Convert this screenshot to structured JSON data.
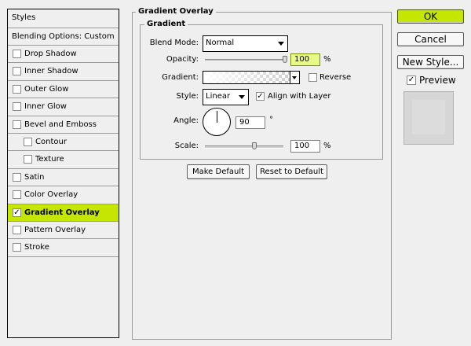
{
  "sidebar": {
    "header": "Styles",
    "blending_options": "Blending Options: Custom",
    "items": [
      {
        "label": "Drop Shadow",
        "checked": false
      },
      {
        "label": "Inner Shadow",
        "checked": false
      },
      {
        "label": "Outer Glow",
        "checked": false
      },
      {
        "label": "Inner Glow",
        "checked": false
      },
      {
        "label": "Bevel and Emboss",
        "checked": false
      },
      {
        "label": "Contour",
        "checked": false
      },
      {
        "label": "Texture",
        "checked": false
      },
      {
        "label": "Satin",
        "checked": false
      },
      {
        "label": "Color Overlay",
        "checked": false
      },
      {
        "label": "Gradient Overlay",
        "checked": true
      },
      {
        "label": "Pattern Overlay",
        "checked": false
      },
      {
        "label": "Stroke",
        "checked": false
      }
    ],
    "check_mark": "✓",
    "active_color": "#c4e600"
  },
  "panel": {
    "title": "Gradient Overlay",
    "group_title": "Gradient",
    "blend_mode": {
      "label": "Blend Mode:",
      "value": "Normal"
    },
    "opacity": {
      "label": "Opacity:",
      "value": "100",
      "unit": "%",
      "level": 1.0
    },
    "gradient": {
      "label": "Gradient:",
      "reverse_label": "Reverse",
      "reverse_checked": false
    },
    "style": {
      "label": "Style:",
      "value": "Linear",
      "align_label": "Align with Layer",
      "align_checked": true
    },
    "angle": {
      "label": "Angle:",
      "value": "90",
      "unit": "°"
    },
    "scale": {
      "label": "Scale:",
      "value": "100",
      "unit": "%",
      "level": 0.5
    },
    "make_default": "Make Default",
    "reset_default": "Reset to Default"
  },
  "actions": {
    "ok": "OK",
    "cancel": "Cancel",
    "new_style": "New Style...",
    "preview_label": "Preview",
    "preview_checked": true
  },
  "icons": {
    "dropdown": "chevron-down-icon",
    "angle": "angle-dial-icon"
  }
}
